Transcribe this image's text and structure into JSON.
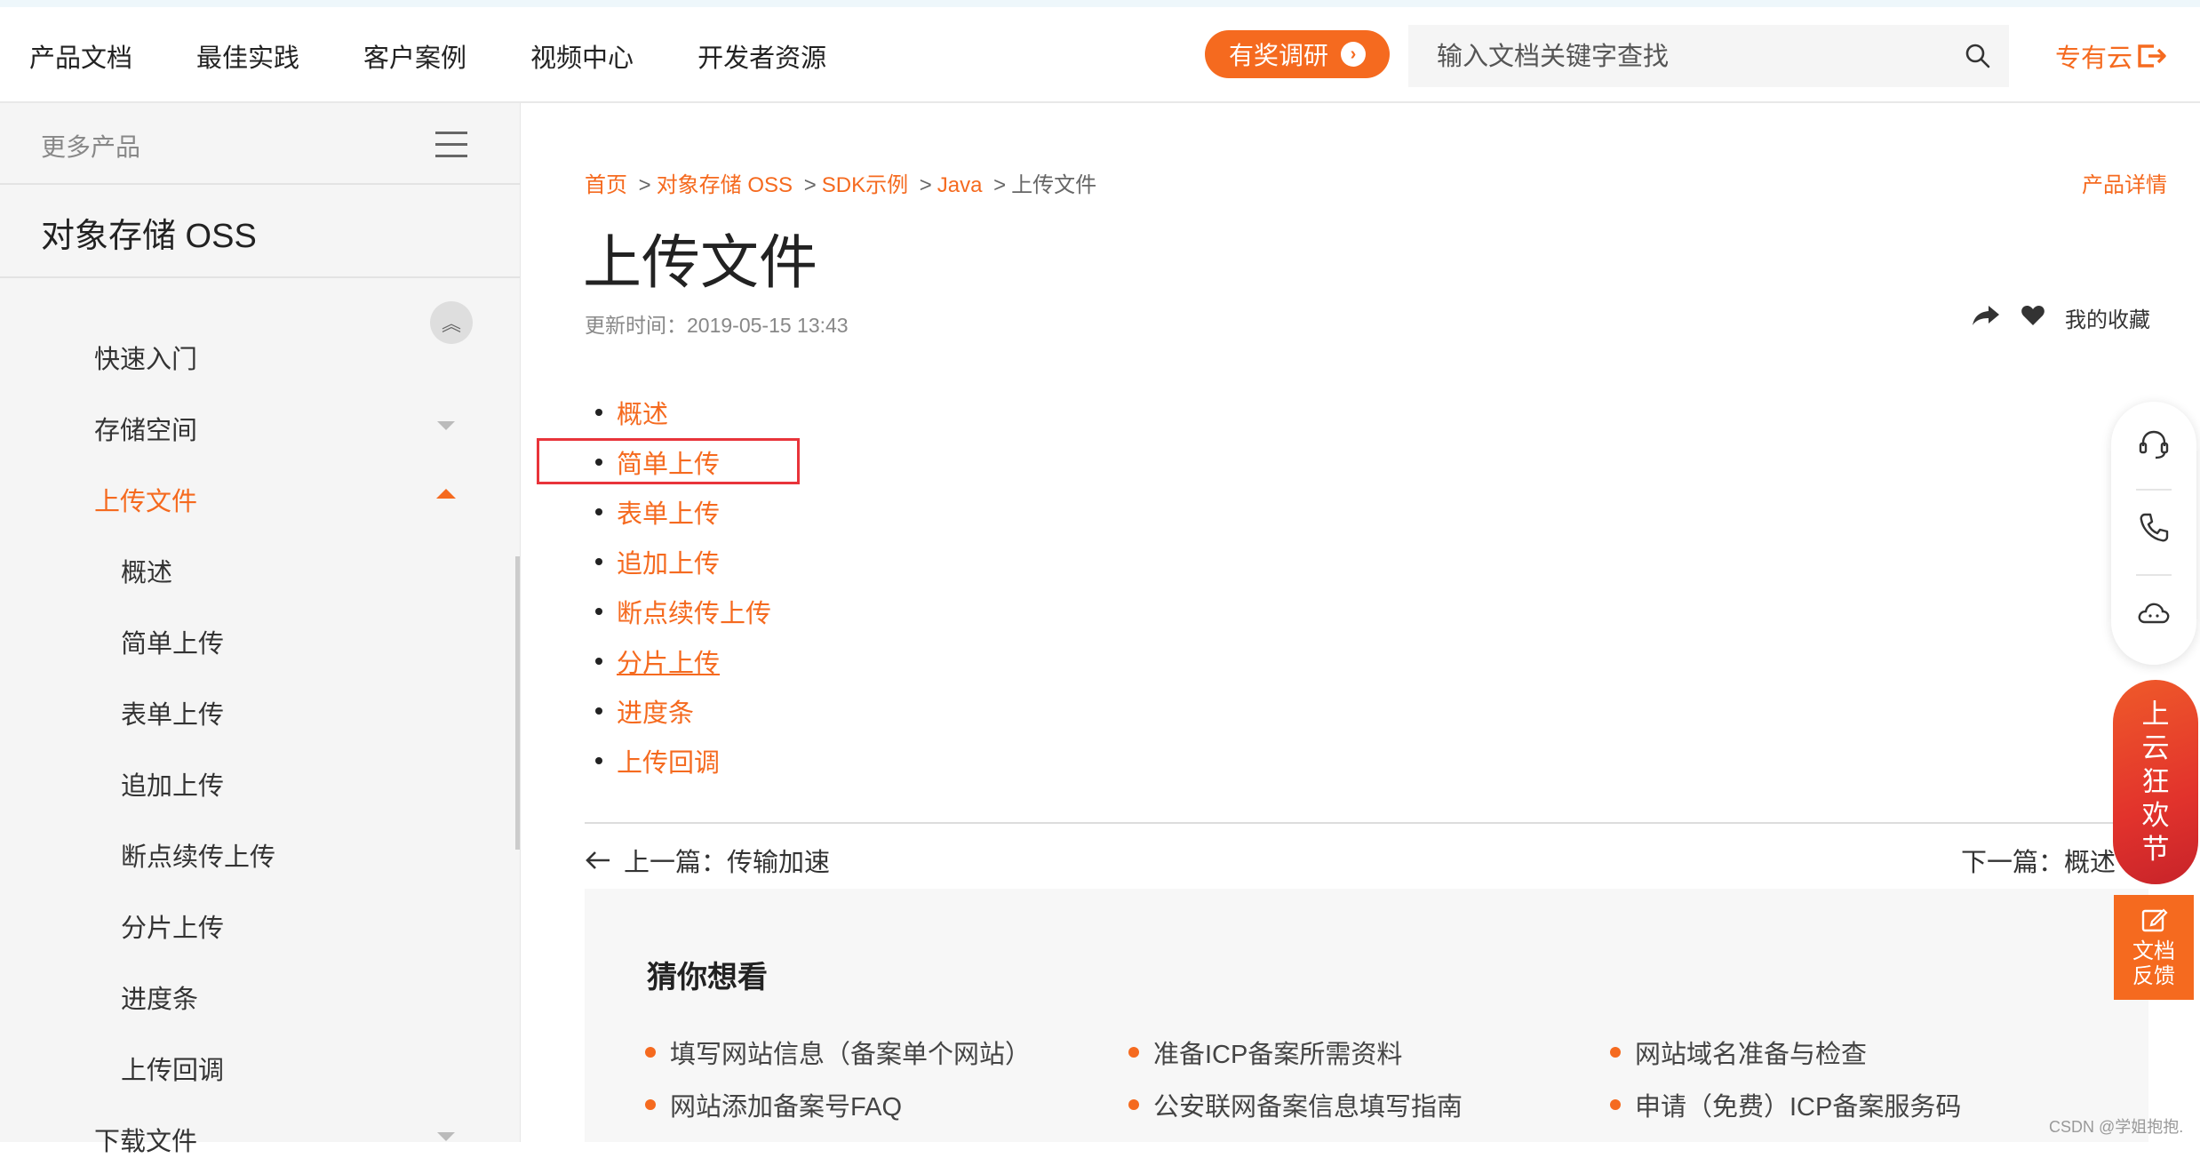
{
  "header": {
    "nav": [
      "产品文档",
      "最佳实践",
      "客户案例",
      "视频中心",
      "开发者资源"
    ],
    "survey_button": "有奖调研",
    "search_placeholder": "输入文档关键字查找",
    "private_cloud": "专有云"
  },
  "sidebar": {
    "more_products": "更多产品",
    "product_title": "对象存储 OSS",
    "items": [
      {
        "label": "快速入门"
      },
      {
        "label": "存储空间"
      },
      {
        "label": "上传文件"
      },
      {
        "label": "概述"
      },
      {
        "label": "简单上传"
      },
      {
        "label": "表单上传"
      },
      {
        "label": "追加上传"
      },
      {
        "label": "断点续传上传"
      },
      {
        "label": "分片上传"
      },
      {
        "label": "进度条"
      },
      {
        "label": "上传回调"
      },
      {
        "label": "下载文件"
      }
    ]
  },
  "breadcrumb": {
    "home": "首页",
    "oss": "对象存储 OSS",
    "sdk": "SDK示例",
    "java": "Java",
    "current": "上传文件",
    "sep": ">"
  },
  "product_detail": "产品详情",
  "page": {
    "title": "上传文件",
    "update_time": "更新时间：2019-05-15 13:43",
    "favorites": "我的收藏"
  },
  "toc": [
    "概述",
    "简单上传",
    "表单上传",
    "追加上传",
    "断点续传上传",
    "分片上传",
    "进度条",
    "上传回调"
  ],
  "pager": {
    "prev": "上一篇：传输加速",
    "next": "下一篇：概述"
  },
  "guess": {
    "title": "猜你想看",
    "items": [
      "填写网站信息（备案单个网站）",
      "准备ICP备案所需资料",
      "网站域名准备与检查",
      "网站添加备案号FAQ",
      "公安联网备案信息填写指南",
      "申请（免费）ICP备案服务码"
    ]
  },
  "float": {
    "promo": [
      "上",
      "云",
      "狂",
      "欢",
      "节"
    ],
    "feedback": [
      "文档",
      "反馈"
    ]
  },
  "watermark": "CSDN @学姐抱抱.",
  "colors": {
    "accent": "#f56a1f",
    "highlight_box": "#e8343a",
    "sidebar_bg": "#f5f5f5"
  }
}
